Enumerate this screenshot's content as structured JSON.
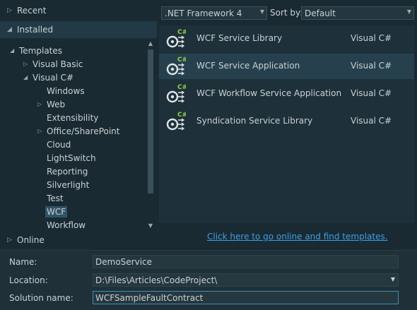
{
  "sidebar": {
    "recent": "Recent",
    "installed": "Installed",
    "online": "Online",
    "tree": [
      {
        "label": "Templates",
        "level": 0,
        "expander": "down"
      },
      {
        "label": "Visual Basic",
        "level": 1,
        "expander": "right"
      },
      {
        "label": "Visual C#",
        "level": 1,
        "expander": "down"
      },
      {
        "label": "Windows",
        "level": 2,
        "expander": "none"
      },
      {
        "label": "Web",
        "level": 2,
        "expander": "right"
      },
      {
        "label": "Extensibility",
        "level": 2,
        "expander": "none"
      },
      {
        "label": "Office/SharePoint",
        "level": 2,
        "expander": "right"
      },
      {
        "label": "Cloud",
        "level": 2,
        "expander": "none"
      },
      {
        "label": "LightSwitch",
        "level": 2,
        "expander": "none"
      },
      {
        "label": "Reporting",
        "level": 2,
        "expander": "none"
      },
      {
        "label": "Silverlight",
        "level": 2,
        "expander": "none"
      },
      {
        "label": "Test",
        "level": 2,
        "expander": "none"
      },
      {
        "label": "WCF",
        "level": 2,
        "expander": "none",
        "selected": true
      },
      {
        "label": "Workflow",
        "level": 2,
        "expander": "none"
      }
    ]
  },
  "toolbar": {
    "framework": ".NET Framework 4",
    "sort_label": "Sort by:",
    "sort_value": "Default"
  },
  "templates": [
    {
      "name": "WCF Service Library",
      "lang": "Visual C#",
      "selected": false
    },
    {
      "name": "WCF Service Application",
      "lang": "Visual C#",
      "selected": true
    },
    {
      "name": "WCF Workflow Service Application",
      "lang": "Visual C#",
      "selected": false
    },
    {
      "name": "Syndication Service Library",
      "lang": "Visual C#",
      "selected": false
    }
  ],
  "icon_badge": "C#",
  "online_link": "Click here to go online and find templates.",
  "form": {
    "name_label": "Name:",
    "name_value": "DemoService",
    "location_label": "Location:",
    "location_value": "D:\\Files\\Articles\\CodeProject\\",
    "solution_label": "Solution name:",
    "solution_value": "WCFSampleFaultContract"
  },
  "colors": {
    "background": "#1a2a32",
    "selection": "#26414d",
    "link": "#3aa0e6",
    "badge": "#8fd14f"
  }
}
